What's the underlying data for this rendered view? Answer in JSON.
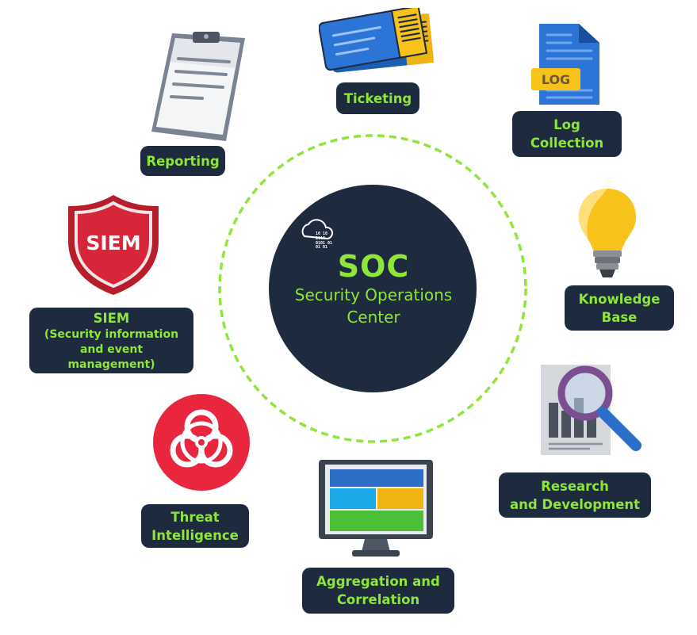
{
  "center": {
    "title": "SOC",
    "subtitle_line1": "Security Operations",
    "subtitle_line2": "Center"
  },
  "nodes": {
    "reporting": "Reporting",
    "ticketing": "Ticketing",
    "log_collection_line1": "Log",
    "log_collection_line2": "Collection",
    "knowledge_base_line1": "Knowledge",
    "knowledge_base_line2": "Base",
    "research_line1": "Research",
    "research_line2": "and Development",
    "aggregation_line1": "Aggregation and",
    "aggregation_line2": "Correlation",
    "threat_line1": "Threat",
    "threat_line2": "Intelligence",
    "siem_line1": "SIEM",
    "siem_line2": "(Security information",
    "siem_line3": "and event management)"
  },
  "icons": {
    "log_badge": "LOG",
    "siem_badge": "SIEM"
  },
  "colors": {
    "accent": "#8ee63b",
    "panel": "#1e2a3e",
    "biohazard": "#e8273f"
  }
}
